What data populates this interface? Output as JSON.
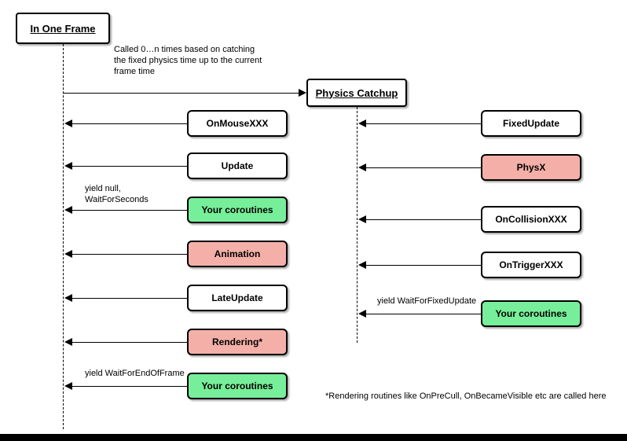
{
  "header": {
    "frame_title": "In One Frame",
    "physics_title": "Physics Catchup"
  },
  "labels": {
    "catchup_note_l1": "Called 0…n times based on catching",
    "catchup_note_l2": "the fixed physics time up to the current",
    "catchup_note_l3": "frame time",
    "yield_null": "yield null,",
    "wait_seconds": "WaitForSeconds",
    "wait_end_frame": "yield WaitForEndOfFrame",
    "wait_fixed": "yield WaitForFixedUpdate"
  },
  "left_steps": {
    "on_mouse": "OnMouseXXX",
    "update": "Update",
    "coroutines1": "Your coroutines",
    "animation": "Animation",
    "late_update": "LateUpdate",
    "rendering": "Rendering*",
    "coroutines2": "Your coroutines"
  },
  "right_steps": {
    "fixed_update": "FixedUpdate",
    "physx": "PhysX",
    "on_collision": "OnCollisionXXX",
    "on_trigger": "OnTriggerXXX",
    "coroutines": "Your coroutines"
  },
  "footnote": "*Rendering routines like OnPreCull, OnBecameVisible etc are called here",
  "chart_data": {
    "type": "sequence-diagram",
    "lifelines": [
      "In One Frame",
      "Physics Catchup"
    ],
    "message": {
      "from": "In One Frame",
      "to": "Physics Catchup",
      "note": "Called 0…n times based on catching the fixed physics time up to the current frame time"
    },
    "frame_sequence": [
      {
        "step": "OnMouseXXX",
        "color": "white"
      },
      {
        "step": "Update",
        "color": "white"
      },
      {
        "step": "Your coroutines",
        "color": "green",
        "yield": "yield null, WaitForSeconds"
      },
      {
        "step": "Animation",
        "color": "pink"
      },
      {
        "step": "LateUpdate",
        "color": "white"
      },
      {
        "step": "Rendering*",
        "color": "pink"
      },
      {
        "step": "Your coroutines",
        "color": "green",
        "yield": "yield WaitForEndOfFrame"
      }
    ],
    "physics_sequence": [
      {
        "step": "FixedUpdate",
        "color": "white"
      },
      {
        "step": "PhysX",
        "color": "pink"
      },
      {
        "step": "OnCollisionXXX",
        "color": "white"
      },
      {
        "step": "OnTriggerXXX",
        "color": "white"
      },
      {
        "step": "Your coroutines",
        "color": "green",
        "yield": "yield WaitForFixedUpdate"
      }
    ],
    "footnote": "*Rendering routines like OnPreCull, OnBecameVisible etc are called here"
  }
}
